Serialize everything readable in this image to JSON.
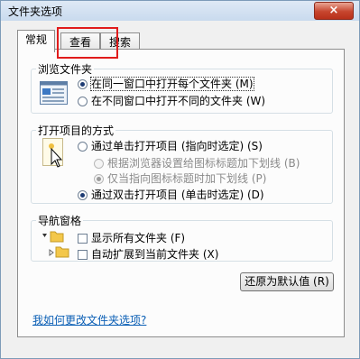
{
  "window": {
    "title": "文件夹选项",
    "close_label": "×"
  },
  "tabs": [
    {
      "label": "常规",
      "active": true
    },
    {
      "label": "查看",
      "active": false,
      "highlighted": true
    },
    {
      "label": "搜索",
      "active": false
    }
  ],
  "browse": {
    "title": "浏览文件夹",
    "options": [
      {
        "label": "在同一窗口中打开每个文件夹 (M)",
        "selected": true
      },
      {
        "label": "在不同窗口中打开不同的文件夹 (W)",
        "selected": false
      }
    ]
  },
  "open_items": {
    "title": "打开项目的方式",
    "single_click": "通过单击打开项目 (指向时选定) (S)",
    "sub_options": [
      {
        "label": "根据浏览器设置给图标标题加下划线 (B)",
        "selected": false,
        "disabled": true
      },
      {
        "label": "仅当指向图标标题时加下划线 (P)",
        "selected": true,
        "disabled": true
      }
    ],
    "double_click": "通过双击打开项目 (单击时选定) (D)",
    "double_selected": true
  },
  "nav_pane": {
    "title": "导航窗格",
    "options": [
      {
        "label": "显示所有文件夹 (F)",
        "checked": false
      },
      {
        "label": "自动扩展到当前文件夹 (X)",
        "checked": false
      }
    ]
  },
  "restore_button": "还原为默认值 (R)",
  "help_link": "我如何更改文件夹选项?",
  "colors": {
    "accent_link": "#0b5fb5",
    "highlight_box": "#e11c1c"
  }
}
